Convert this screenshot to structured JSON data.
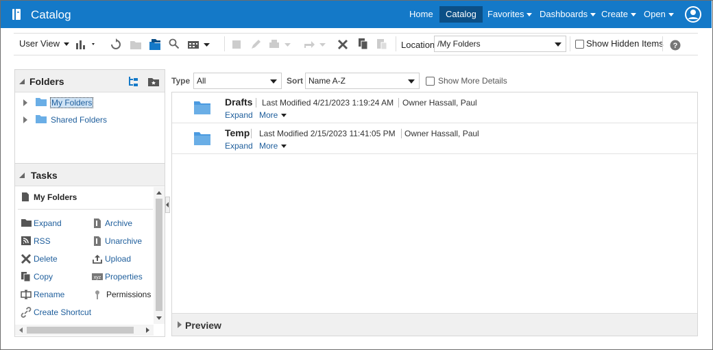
{
  "header": {
    "app_title": "Catalog",
    "nav": [
      {
        "label": "Home"
      },
      {
        "label": "Catalog"
      },
      {
        "label": "Favorites"
      },
      {
        "label": "Dashboards"
      },
      {
        "label": "Create"
      },
      {
        "label": "Open"
      }
    ],
    "active_nav": "Catalog",
    "brand_color": "#1479c8"
  },
  "toolbar": {
    "view_label": "User View",
    "location_label": "Location",
    "location_value": "/My Folders",
    "show_hidden_label": "Show Hidden Items"
  },
  "folders_panel": {
    "title": "Folders",
    "tree": [
      {
        "label": "My Folders",
        "selected": true
      },
      {
        "label": "Shared Folders",
        "selected": false
      }
    ]
  },
  "tasks_panel": {
    "title": "Tasks",
    "context": "My Folders",
    "left": [
      {
        "label": "Expand",
        "icon": "folder-icon"
      },
      {
        "label": "RSS",
        "icon": "rss-icon"
      },
      {
        "label": "Delete",
        "icon": "delete-icon"
      },
      {
        "label": "Copy",
        "icon": "copy-icon"
      },
      {
        "label": "Rename",
        "icon": "rename-icon"
      },
      {
        "label": "Create Shortcut",
        "icon": "link-icon"
      }
    ],
    "right": [
      {
        "label": "Archive",
        "icon": "archive-icon"
      },
      {
        "label": "Unarchive",
        "icon": "unarchive-icon"
      },
      {
        "label": "Upload",
        "icon": "upload-icon"
      },
      {
        "label": "Properties",
        "icon": "properties-icon"
      },
      {
        "label": "Permissions",
        "icon": "permissions-icon"
      }
    ]
  },
  "filter": {
    "type_label": "Type",
    "type_value": "All",
    "sort_label": "Sort",
    "sort_value": "Name A-Z",
    "more_details_label": "Show More Details"
  },
  "items": [
    {
      "name": "Drafts",
      "modified_label": "Last Modified",
      "modified": "4/21/2023 1:19:24 AM",
      "owner_label": "Owner",
      "owner": "Hassall, Paul",
      "expand": "Expand",
      "more": "More"
    },
    {
      "name": "Temp",
      "modified_label": "Last Modified",
      "modified": "2/15/2023 11:41:05 PM",
      "owner_label": "Owner",
      "owner": "Hassall, Paul",
      "expand": "Expand",
      "more": "More"
    }
  ],
  "preview": {
    "label": "Preview"
  }
}
